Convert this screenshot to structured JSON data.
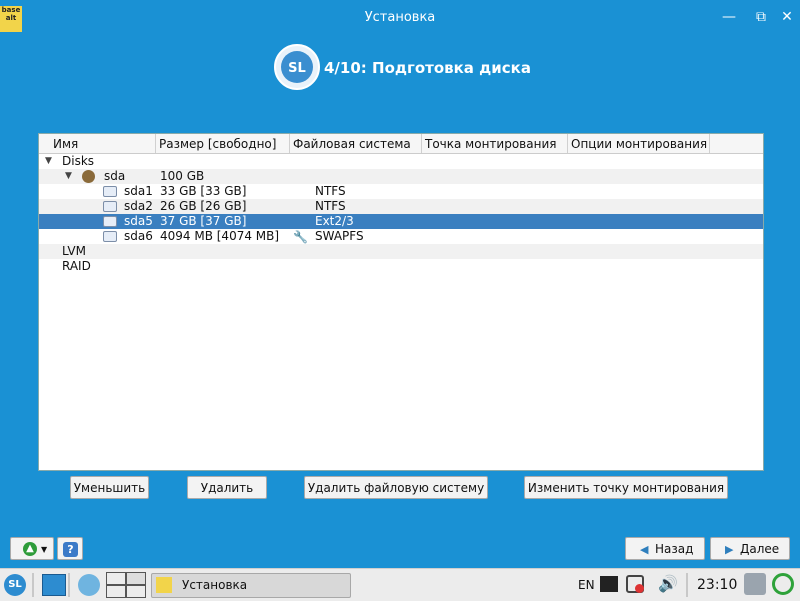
{
  "window": {
    "title": "Установка",
    "app_icon_text": "base alt"
  },
  "step": {
    "title": "4/10: Подготовка диска",
    "logo_text": "SL"
  },
  "table": {
    "columns": [
      "Имя",
      "Размер [свободно]",
      "Файловая система",
      "Точка монтирования",
      "Опции монтирования"
    ],
    "rows": [
      {
        "name": "Disks",
        "size": "",
        "fs": ""
      },
      {
        "name": "sda",
        "size": "100 GB",
        "fs": ""
      },
      {
        "name": "sda1",
        "size": "33 GB [33 GB]",
        "fs": "NTFS"
      },
      {
        "name": "sda2",
        "size": "26 GB [26 GB]",
        "fs": "NTFS"
      },
      {
        "name": "sda5",
        "size": "37 GB [37 GB]",
        "fs": "Ext2/3"
      },
      {
        "name": "sda6",
        "size": "4094 MB [4074 MB]",
        "fs": "SWAPFS"
      },
      {
        "name": "LVM",
        "size": "",
        "fs": ""
      },
      {
        "name": "RAID",
        "size": "",
        "fs": ""
      }
    ]
  },
  "buttons": {
    "shrink": "Уменьшить",
    "delete": "Удалить",
    "delete_fs": "Удалить файловую систему",
    "change_mount": "Изменить точку монтирования",
    "back": "Назад",
    "next": "Далее"
  },
  "taskbar": {
    "start_label": "SL",
    "task_label": "Установка",
    "lang": "EN",
    "clock": "23:10"
  }
}
